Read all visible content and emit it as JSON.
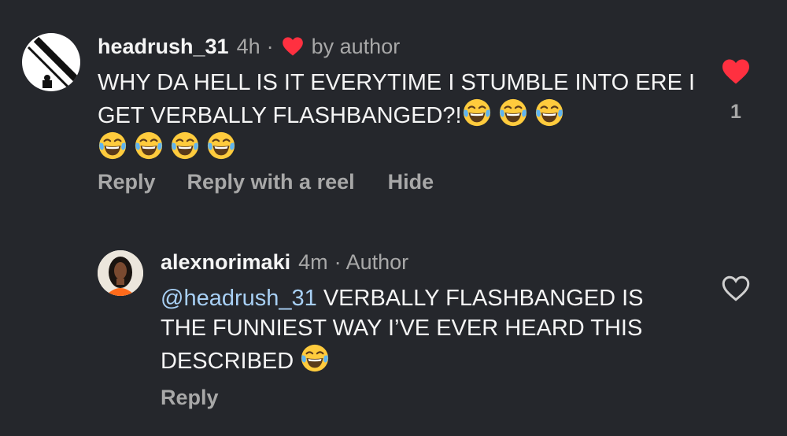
{
  "comments": [
    {
      "username": "headrush_31",
      "time": "4h",
      "separator": "·",
      "liked_by_author_label": "by author",
      "text": "WHY DA HELL IS IT EVERYTIME I STUMBLE INTO ERE I GET VERBALLY FLASHBANGED?!",
      "emoji_count": 7,
      "actions": [
        "Reply",
        "Reply with a reel",
        "Hide"
      ],
      "like_count": "1",
      "liked": true
    },
    {
      "username": "alexnorimaki",
      "time": "4m",
      "separator": "·",
      "author_label": "Author",
      "mention": "@headrush_31",
      "text": "VERBALLY FLASHBANGED IS THE FUNNIEST WAY I’VE EVER HEARD THIS DESCRIBED",
      "emoji_count": 1,
      "actions": [
        "Reply"
      ],
      "liked": false
    }
  ],
  "colors": {
    "background": "#25272c",
    "like_red": "#ff3040",
    "mention_blue": "#a8d0f5",
    "muted_gray": "#a8a8a8"
  },
  "icons": {
    "liked": "heart-filled-icon",
    "unliked": "heart-outline-icon",
    "emoji": "tears-of-joy-emoji"
  }
}
